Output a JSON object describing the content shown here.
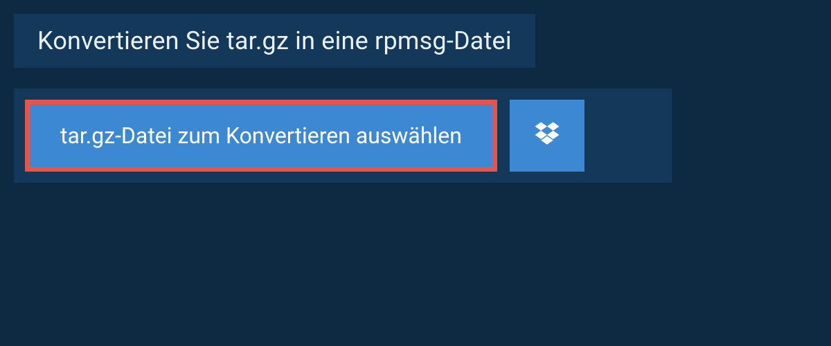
{
  "header": {
    "title": "Konvertieren Sie tar.gz in eine rpmsg-Datei"
  },
  "actions": {
    "select_file_label": "tar.gz-Datei zum Konvertieren auswählen",
    "dropbox_icon": "dropbox-icon"
  },
  "colors": {
    "bg_dark": "#0e2a42",
    "panel": "#14385a",
    "button": "#3d88d2",
    "highlight_border": "#e2564d",
    "text_light": "#eaf1f7"
  }
}
